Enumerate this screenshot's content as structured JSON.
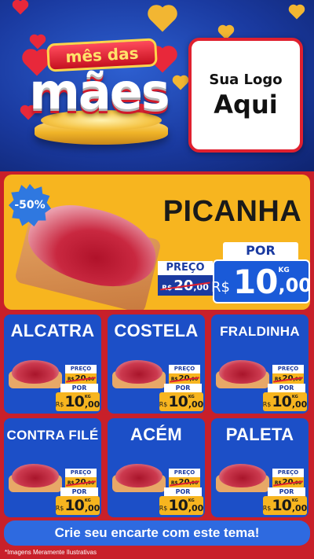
{
  "banner": {
    "title_small": "mês das",
    "title_big": "mães",
    "logo_line1": "Sua Logo",
    "logo_line2": "Aqui"
  },
  "hero": {
    "discount": "-50%",
    "name": "PICANHA",
    "preco_label": "PREÇO",
    "old_currency": "R$",
    "old_integer": "20",
    "old_cents": ",00",
    "por_label": "POR",
    "currency": "R$",
    "integer": "10",
    "cents": ",00",
    "unit": "KG"
  },
  "products": [
    {
      "name": "ALCATRA",
      "preco_label": "PREÇO",
      "old_currency": "R$",
      "old_integer": "20",
      "old_cents": ",00",
      "por_label": "POR",
      "currency": "R$",
      "integer": "10",
      "cents": ",00",
      "unit": "KG"
    },
    {
      "name": "COSTELA",
      "preco_label": "PREÇO",
      "old_currency": "R$",
      "old_integer": "20",
      "old_cents": ",00",
      "por_label": "POR",
      "currency": "R$",
      "integer": "10",
      "cents": ",00",
      "unit": "KG"
    },
    {
      "name": "FRALDINHA",
      "preco_label": "PREÇO",
      "old_currency": "R$",
      "old_integer": "20",
      "old_cents": ",00",
      "por_label": "POR",
      "currency": "R$",
      "integer": "10",
      "cents": ",00",
      "unit": "KG"
    },
    {
      "name": "CONTRA FILÉ",
      "preco_label": "PREÇO",
      "old_currency": "R$",
      "old_integer": "20",
      "old_cents": ",00",
      "por_label": "POR",
      "currency": "R$",
      "integer": "10",
      "cents": ",00",
      "unit": "KG"
    },
    {
      "name": "ACÉM",
      "preco_label": "PREÇO",
      "old_currency": "R$",
      "old_integer": "20",
      "old_cents": ",00",
      "por_label": "POR",
      "currency": "R$",
      "integer": "10",
      "cents": ",00",
      "unit": "KG"
    },
    {
      "name": "PALETA",
      "preco_label": "PREÇO",
      "old_currency": "R$",
      "old_integer": "20",
      "old_cents": ",00",
      "por_label": "POR",
      "currency": "R$",
      "integer": "10",
      "cents": ",00",
      "unit": "KG"
    }
  ],
  "cta_label": "Crie seu encarte com este tema!",
  "footnote": "*Imagens Meramente Ilustrativas",
  "colors": {
    "background_red": "#c8202a",
    "banner_blue": "#1a3aa0",
    "card_blue": "#1c4fc7",
    "price_yellow": "#f7b51f",
    "hero_price_blue": "#1a5ad8"
  }
}
